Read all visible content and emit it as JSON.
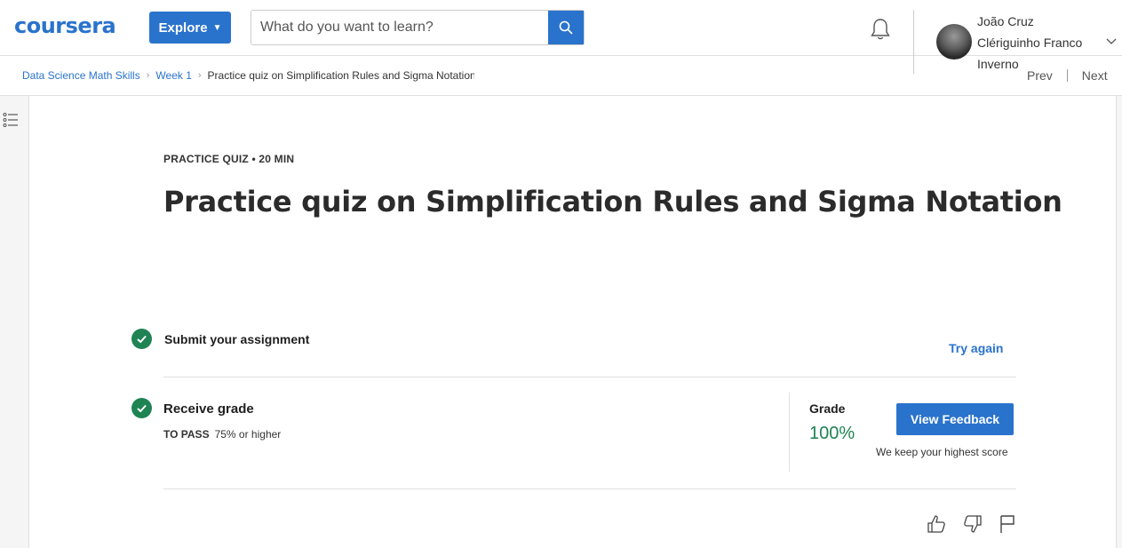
{
  "header": {
    "logo": "coursera",
    "explore_label": "Explore",
    "search_placeholder": "What do you want to learn?",
    "user_name_line1": "João Cruz",
    "user_name_line2": "Clériguinho Franco",
    "user_name_line3": "Inverno"
  },
  "breadcrumb": {
    "items": [
      "Data Science Math Skills",
      "Week 1"
    ],
    "current": "Practice quiz on Simplification Rules and Sigma Notation"
  },
  "nav": {
    "prev": "Prev",
    "next": "Next"
  },
  "quiz": {
    "kicker": "PRACTICE QUIZ • 20 MIN",
    "title": "Practice quiz on Simplification Rules and Sigma Notation",
    "submit_label": "Submit your assignment",
    "try_again": "Try again",
    "receive_label": "Receive grade",
    "to_pass_label": "TO PASS",
    "to_pass_value": "75% or higher",
    "grade_label": "Grade",
    "grade_value": "100%",
    "feedback_button": "View Feedback",
    "highest_note": "We keep your highest score"
  },
  "colors": {
    "brand": "#2a73cc",
    "success": "#1f8354"
  }
}
